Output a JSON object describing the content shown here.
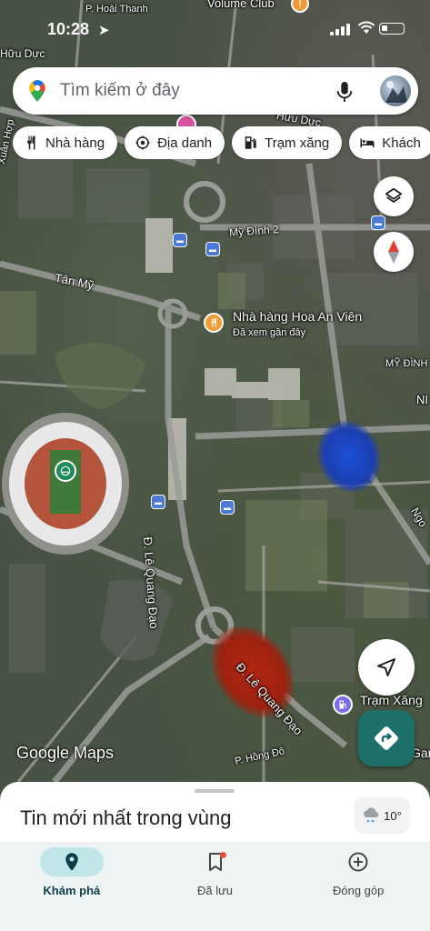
{
  "status_bar": {
    "time": "10:28"
  },
  "map": {
    "labels": {
      "p_hoai_thanh": "P. Hoài Thanh",
      "volume_club": "Volume Club",
      "huu_duc_left": "Hữu Dực",
      "xuan_hop": "Xuân Hợp",
      "huu_duc_right": "Hữu Dực",
      "my_dinh_2": "Mỹ Đình 2",
      "tan_my": "Tân Mỹ",
      "restaurant_name": "Nhà hàng Hoa An Viên",
      "restaurant_sub": "Đã xem gần đây",
      "my_dinh_right": "MỸ ĐÌNH",
      "ni": "NI",
      "ngo": "Ngo",
      "le_quang_dao_vertical": "Đ. Lê Quang Đạo",
      "le_quang_dao_diagonal": "Đ. Lê Quang Đạo",
      "tram_xang_label": "Trạm Xăng",
      "gan": "Gan",
      "p_hong_do": "P. Hồng Đô"
    },
    "attribution": "Google Maps"
  },
  "search": {
    "placeholder": "Tìm kiếm ở đây"
  },
  "chips": [
    {
      "label": "Nhà hàng",
      "icon": "fork-knife-icon"
    },
    {
      "label": "Địa danh",
      "icon": "landmark-icon"
    },
    {
      "label": "Trạm xăng",
      "icon": "gas-station-icon"
    },
    {
      "label": "Khách",
      "icon": "bed-icon"
    }
  ],
  "bottom_sheet": {
    "title": "Tin mới nhất trong vùng",
    "weather": "10°"
  },
  "nav": [
    {
      "label": "Khám phá",
      "icon": "explore-pin-icon",
      "active": true
    },
    {
      "label": "Đã lưu",
      "icon": "bookmark-icon",
      "active": false
    },
    {
      "label": "Đóng góp",
      "icon": "add-circle-icon",
      "active": false
    }
  ],
  "colors": {
    "accent": "#1d6f6a",
    "nav_active_bg": "#c0e6ea",
    "restaurant_pin": "#f29b34",
    "gas_pin": "#7a6ee8"
  }
}
